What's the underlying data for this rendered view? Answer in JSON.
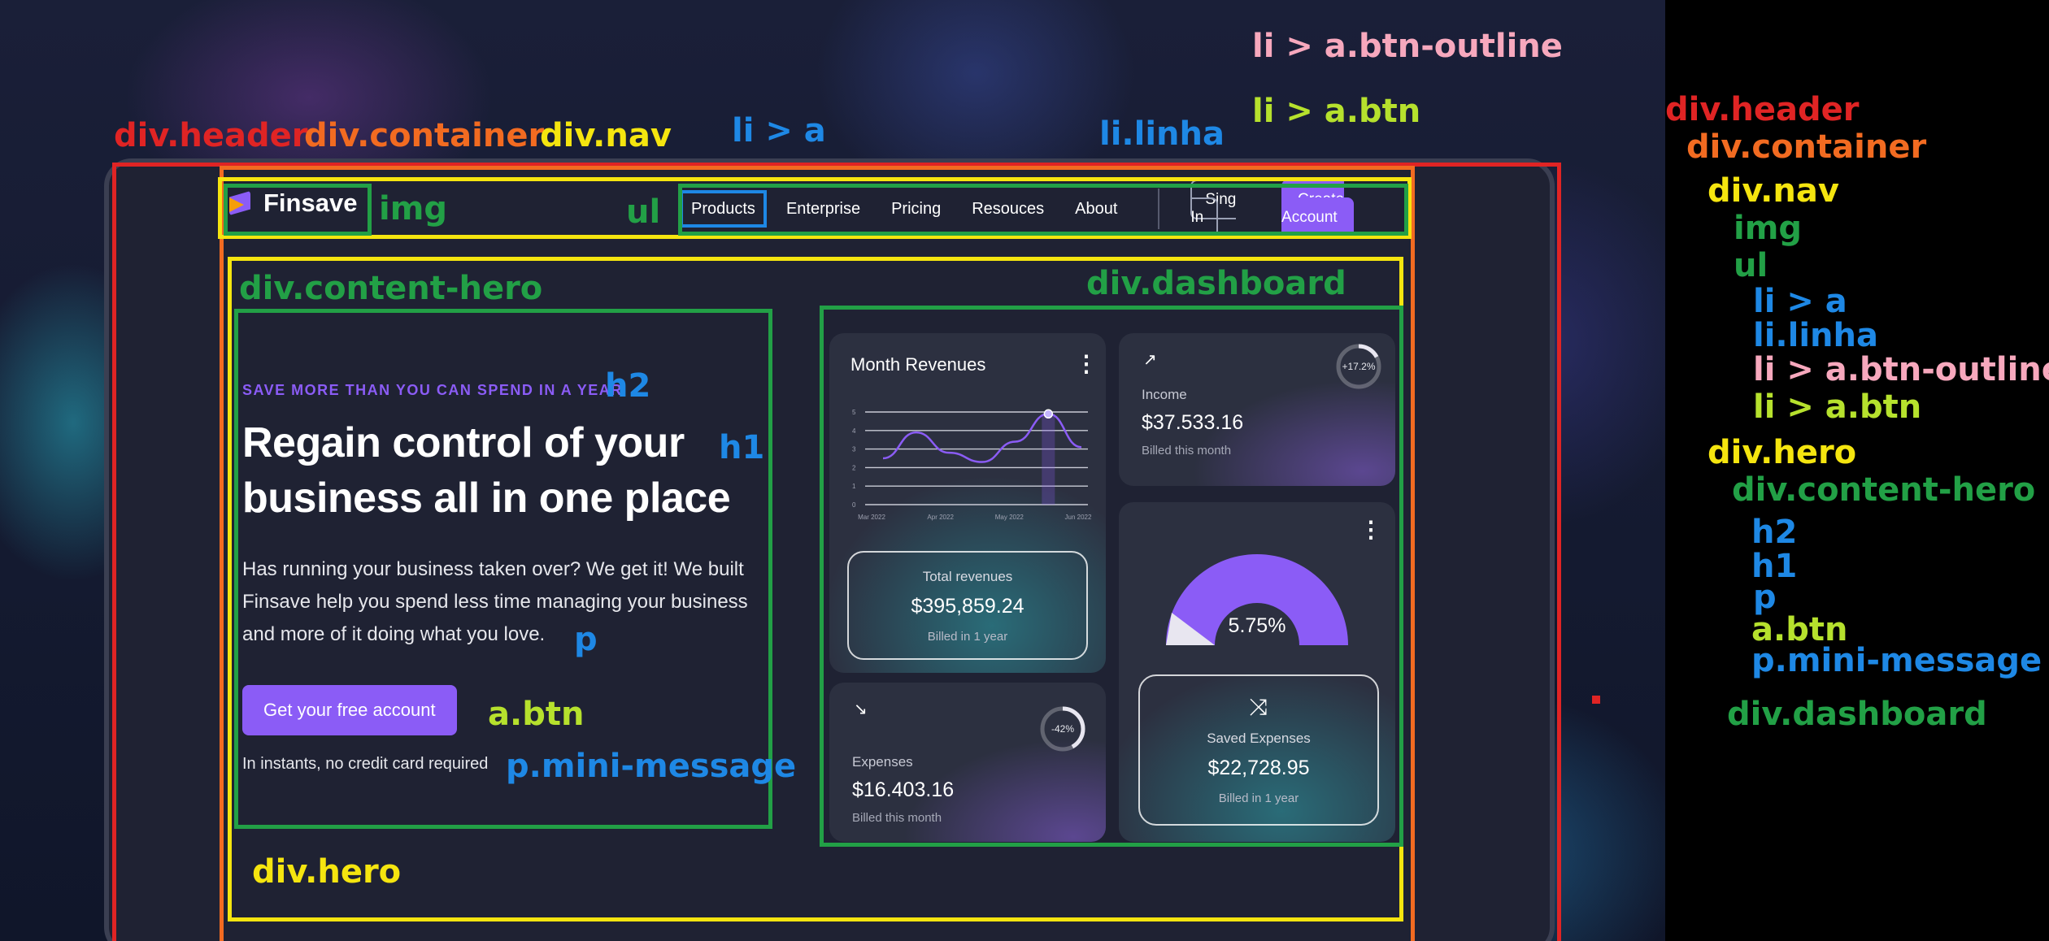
{
  "colors": {
    "red": "#e02424",
    "orange": "#f26b21",
    "yellow": "#f5e50f",
    "green": "#22a046",
    "blue": "#1e88e5",
    "pink": "#f7a8bd",
    "lime": "#b6e12d",
    "purple": "#8b5cf6"
  },
  "nav": {
    "logo_text": "Finsave",
    "links": [
      "Products",
      "Enterprise",
      "Pricing",
      "Resouces",
      "About"
    ],
    "signin_label": "Sing In",
    "create_label": "Create Account"
  },
  "hero": {
    "eyebrow": "SAVE MORE THAN YOU CAN SPEND IN A YEAR",
    "title_line1": "Regain control of your",
    "title_line2": "business all in one place",
    "text_line1": "Has running your business taken over? We get it! We built",
    "text_line2": "Finsave help you spend less time managing your business",
    "text_line3": "and more of it doing what you love.",
    "cta_label": "Get your free account",
    "mini_message": "In instants, no credit card required"
  },
  "dashboard": {
    "revenues": {
      "title": "Month Revenues",
      "total_label": "Total revenues",
      "total_value": "$395,859.24",
      "total_note": "Billed in 1 year"
    },
    "income": {
      "badge": "+17.2%",
      "badge_fraction": 0.172,
      "label": "Income",
      "value": "$37.533.16",
      "note": "Billed this month"
    },
    "expenses": {
      "badge": "-42%",
      "badge_fraction": 0.42,
      "label": "Expenses",
      "value": "$16.403.16",
      "note": "Billed this month"
    },
    "saved": {
      "gauge_value": "5.75%",
      "label": "Saved Expenses",
      "value": "$22,728.95",
      "note": "Billed in 1 year"
    }
  },
  "chart_data": {
    "type": "line",
    "title": "Month Revenues",
    "xlabel": "",
    "ylabel": "",
    "x_ticks": [
      "Mar 2022",
      "Apr 2022",
      "May 2022",
      "Jun 2022"
    ],
    "y_ticks": [
      0,
      1,
      2,
      3,
      4,
      5
    ],
    "ylim": [
      0,
      5
    ],
    "grid": true,
    "series": [
      {
        "values": [
          2.5,
          3.9,
          2.8,
          2.3,
          3.4,
          4.9,
          3.1
        ]
      }
    ]
  },
  "annotations": {
    "header": "div.header",
    "container": "div.container",
    "nav": "div.nav",
    "li_a": "li  > a",
    "li_linha": "li.linha",
    "btn_outline": "li > a.btn-outline",
    "btn": "li > a.btn",
    "img": "img",
    "ul": "ul",
    "content_hero": "div.content-hero",
    "dashboard": "div.dashboard",
    "h2": "h2",
    "h1": "h1",
    "p": "p",
    "a_btn": "a.btn",
    "p_mini": "p.mini-message",
    "hero": "div.hero"
  },
  "tree": [
    {
      "label": "div.header",
      "color": "red"
    },
    {
      "label": "div.container",
      "color": "orange"
    },
    {
      "label": "div.nav",
      "color": "yellow"
    },
    {
      "label": "img",
      "color": "green"
    },
    {
      "label": "ul",
      "color": "green"
    },
    {
      "label": "li > a",
      "color": "blue"
    },
    {
      "label": "li.linha",
      "color": "blue"
    },
    {
      "label": "li > a.btn-outline",
      "color": "pink"
    },
    {
      "label": "li > a.btn",
      "color": "lime"
    },
    {
      "label": "div.hero",
      "color": "yellow"
    },
    {
      "label": "div.content-hero",
      "color": "green"
    },
    {
      "label": "h2",
      "color": "blue"
    },
    {
      "label": "h1",
      "color": "blue"
    },
    {
      "label": "p",
      "color": "blue"
    },
    {
      "label": "a.btn",
      "color": "lime"
    },
    {
      "label": "p.mini-message",
      "color": "blue"
    },
    {
      "label": "div.dashboard",
      "color": "green"
    }
  ]
}
